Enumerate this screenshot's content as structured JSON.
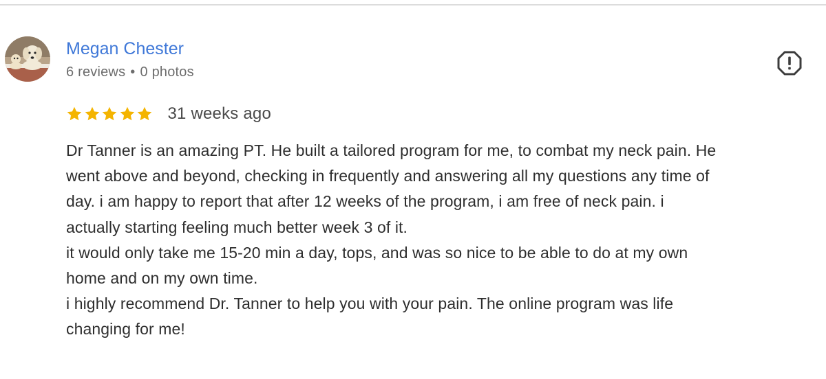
{
  "reviewer": {
    "name": "Megan Chester",
    "reviews_count": "6 reviews",
    "separator": "•",
    "photos_count": "0 photos",
    "avatar_icon": "avatar-photo-dogs"
  },
  "actions": {
    "flag_icon": "report-flag-icon"
  },
  "rating": {
    "stars": 5,
    "max_stars": 5,
    "star_color": "#f4b400",
    "date": "31 weeks ago"
  },
  "review": {
    "lines": [
      "Dr Tanner is an amazing PT. He built a tailored program for me, to combat my neck pain. He",
      "went above and beyond, checking in frequently and answering all my questions any time of",
      "day. i am happy to report that after 12 weeks of the program, i am free of neck pain. i",
      "actually starting feeling much better week 3 of it.",
      "it would only take me 15-20 min a day, tops, and was so nice to be able to do at my own",
      "home and on my own time.",
      "i highly recommend Dr. Tanner to help you with your pain. The online program was life",
      "changing for me!"
    ]
  },
  "colors": {
    "name_link": "#3f78d8",
    "meta_text": "#6d6d6d",
    "body_text": "#2e2e2e",
    "divider": "#dcdcdc"
  }
}
